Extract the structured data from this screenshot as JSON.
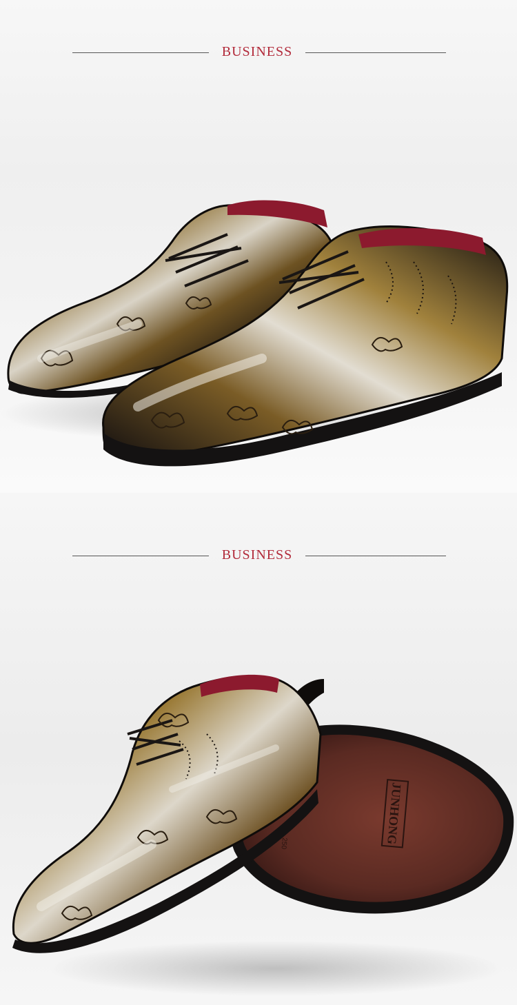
{
  "sections": [
    {
      "heading": "BUSINESS",
      "image_alt": "glossy floral patterned bronze lace-up pointed dress shoes pair"
    },
    {
      "heading": "BUSINESS",
      "image_alt": "glossy floral patterned bronze dress shoe with second shoe showing sole"
    }
  ],
  "sole_brand": "JUNHONG",
  "sole_size": "250",
  "colors": {
    "heading": "#b22a3a",
    "rule": "#555555",
    "bronze": "#8a6a2a",
    "gloss": "#d8d2c4",
    "black": "#121212",
    "lining": "#8c1a2e",
    "sole": "#5a2a22"
  }
}
